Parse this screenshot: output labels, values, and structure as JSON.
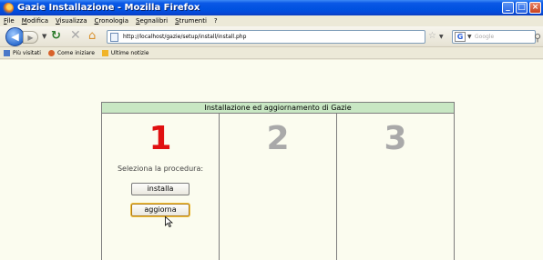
{
  "window": {
    "title": "Gazie Installazione - Mozilla Firefox",
    "controls": [
      "_",
      "□",
      "×"
    ]
  },
  "menu": [
    "File",
    "Modifica",
    "Visualizza",
    "Cronologia",
    "Segnalibri",
    "Strumenti",
    "?"
  ],
  "nav": {
    "url": "http://localhost/gazie/setup/install/install.php",
    "search_placeholder": "Google",
    "search_engine_icon": "G"
  },
  "bookmarks": [
    "Più visitati",
    "Come iniziare",
    "Ultime notizie"
  ],
  "page": {
    "header": "Installazione ed aggiornamento di Gazie",
    "steps": [
      "1",
      "2",
      "3"
    ],
    "procedure_label": "Seleziona la procedura:",
    "install_button": "installa",
    "update_button": "aggiorna"
  },
  "colors": {
    "header_bg": "#c8e7c3",
    "page_bg": "#fbfcef",
    "active_step": "#e01010",
    "inactive_step": "#a9a9a9"
  }
}
